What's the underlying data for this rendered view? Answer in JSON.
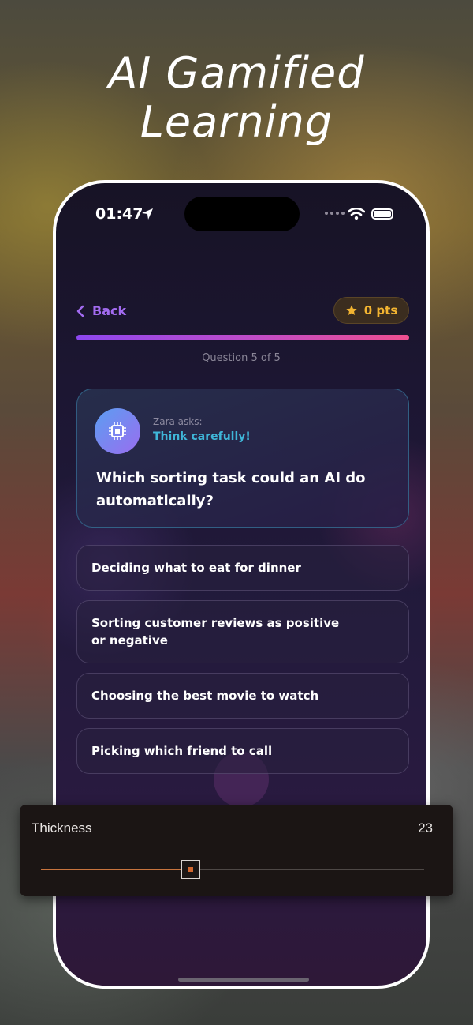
{
  "hero": {
    "line1": "AI Gamified",
    "line2": "Learning"
  },
  "status_bar": {
    "time": "01:47"
  },
  "header": {
    "back_label": "Back",
    "points_label": "0 pts"
  },
  "quiz": {
    "progress": 1.0,
    "question_counter": "Question 5 of 5",
    "asker": "Zara asks:",
    "prompt_hint": "Think carefully!",
    "question": "Which sorting task could an AI do automatically?",
    "answers": [
      "Deciding what to eat for dinner",
      "Sorting customer reviews as positive or negative",
      "Choosing the best movie to watch",
      "Picking which friend to call"
    ]
  },
  "thickness_panel": {
    "label": "Thickness",
    "value": "23",
    "fraction": 0.39
  },
  "colors": {
    "accent_purple": "#a26bf0",
    "points_gold": "#f2b431",
    "hint_cyan": "#3fb6d8",
    "slider_orange": "#c8743e"
  }
}
